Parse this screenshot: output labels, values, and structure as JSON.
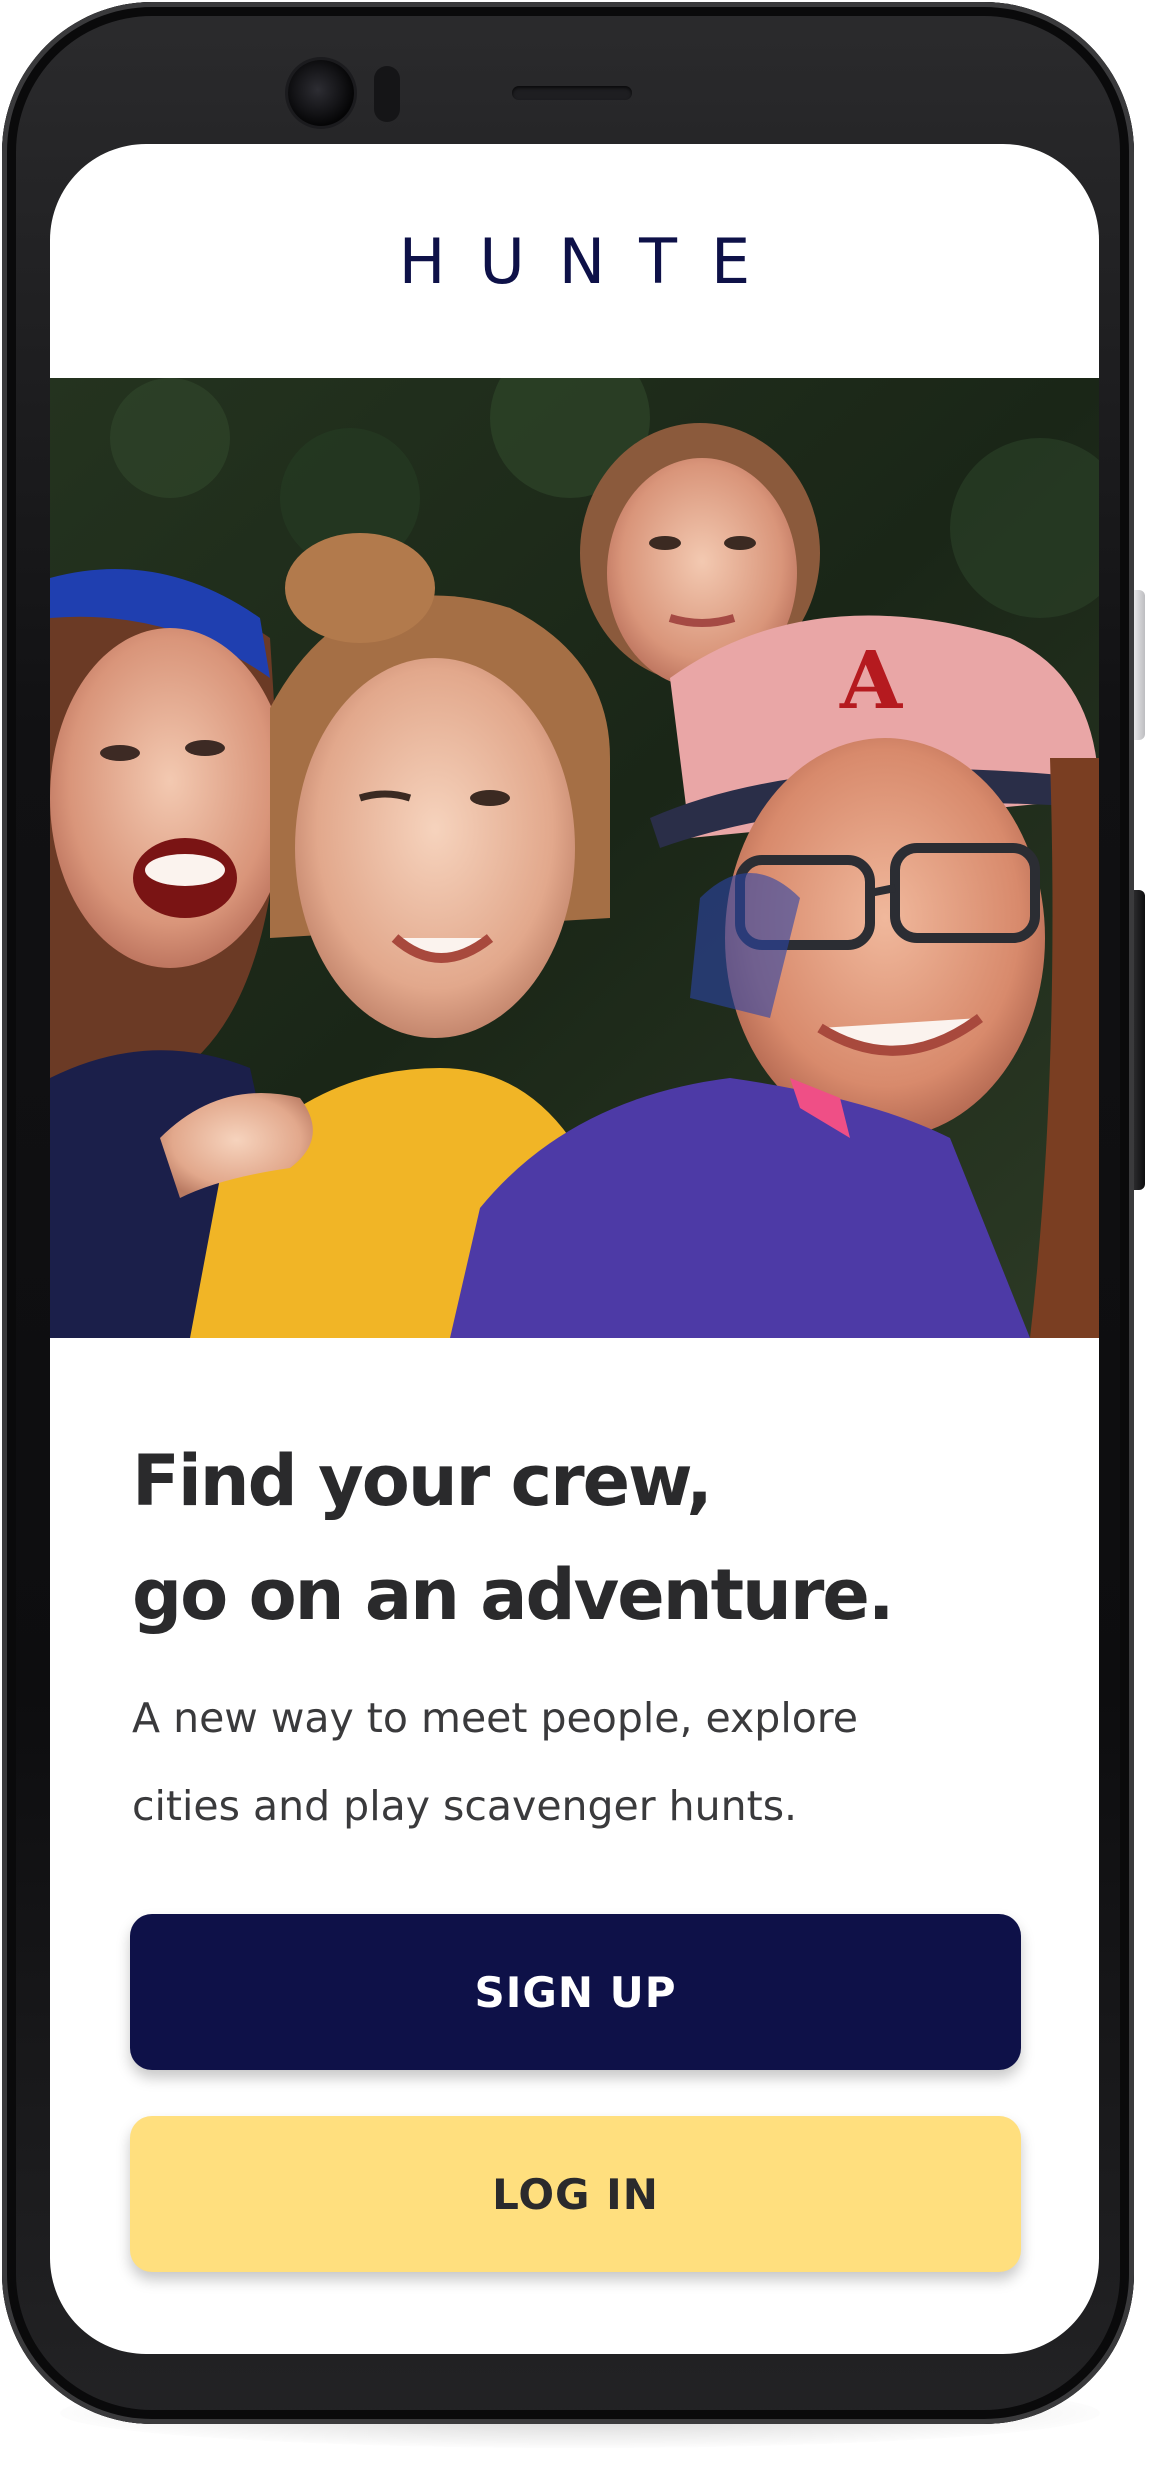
{
  "app": {
    "brand_name": "HUNTE"
  },
  "hero": {
    "image": "group-selfie-of-four-women-outdoors"
  },
  "onboarding": {
    "headline_line1": "Find your crew,",
    "headline_line2": "go on an adventure.",
    "subtext_line1": "A new way to meet people, explore",
    "subtext_line2": "cities and play scavenger hunts."
  },
  "actions": {
    "signup_label": "SIGN UP",
    "login_label": "LOG IN"
  },
  "colors": {
    "brand_navy": "#0e1148",
    "login_yellow": "#ffdf7e",
    "text_dark": "#2a2a2c",
    "screen_bg": "#ffffff"
  }
}
